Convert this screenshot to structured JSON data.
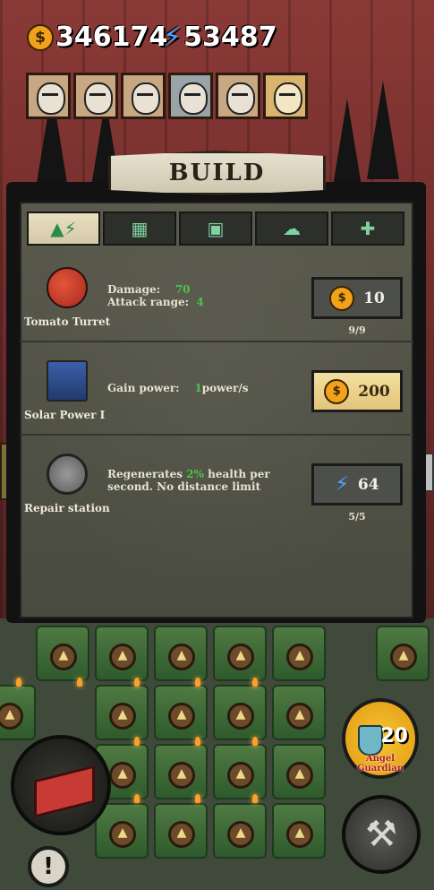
{
  "resources": {
    "coins": "346174",
    "energy": "53487"
  },
  "icons": {
    "coin": "coin-icon",
    "energy": "lightning-icon"
  },
  "portraits": [
    "character-1",
    "character-2",
    "character-3",
    "character-4",
    "character-5",
    "character-6"
  ],
  "build_panel": {
    "title": "BUILD",
    "tabs": [
      "attack-turret-tab",
      "power-tab",
      "frame-tab",
      "support-tab",
      "repair-tab"
    ],
    "items": [
      {
        "name": "Tomato Turret",
        "stats": [
          {
            "label": "Damage:",
            "value": "70"
          },
          {
            "label": "Attack range:",
            "value": "4"
          }
        ],
        "cost": "10",
        "cost_type": "coin",
        "count": "9/9"
      },
      {
        "name": "Solar Power I",
        "desc_label": "Gain power:",
        "desc_value": "1",
        "desc_unit": "power/s",
        "cost": "200",
        "cost_type": "coin",
        "count": ""
      },
      {
        "name": "Repair station",
        "desc_pre": "Regenerates",
        "desc_value": "2%",
        "desc_post": "health per second. No distance limit",
        "cost": "64",
        "cost_type": "energy",
        "count": "5/5"
      }
    ]
  },
  "angel": {
    "count": "20",
    "label_line1": "Angel",
    "label_line2": "Guardian"
  },
  "alert_label": "!"
}
